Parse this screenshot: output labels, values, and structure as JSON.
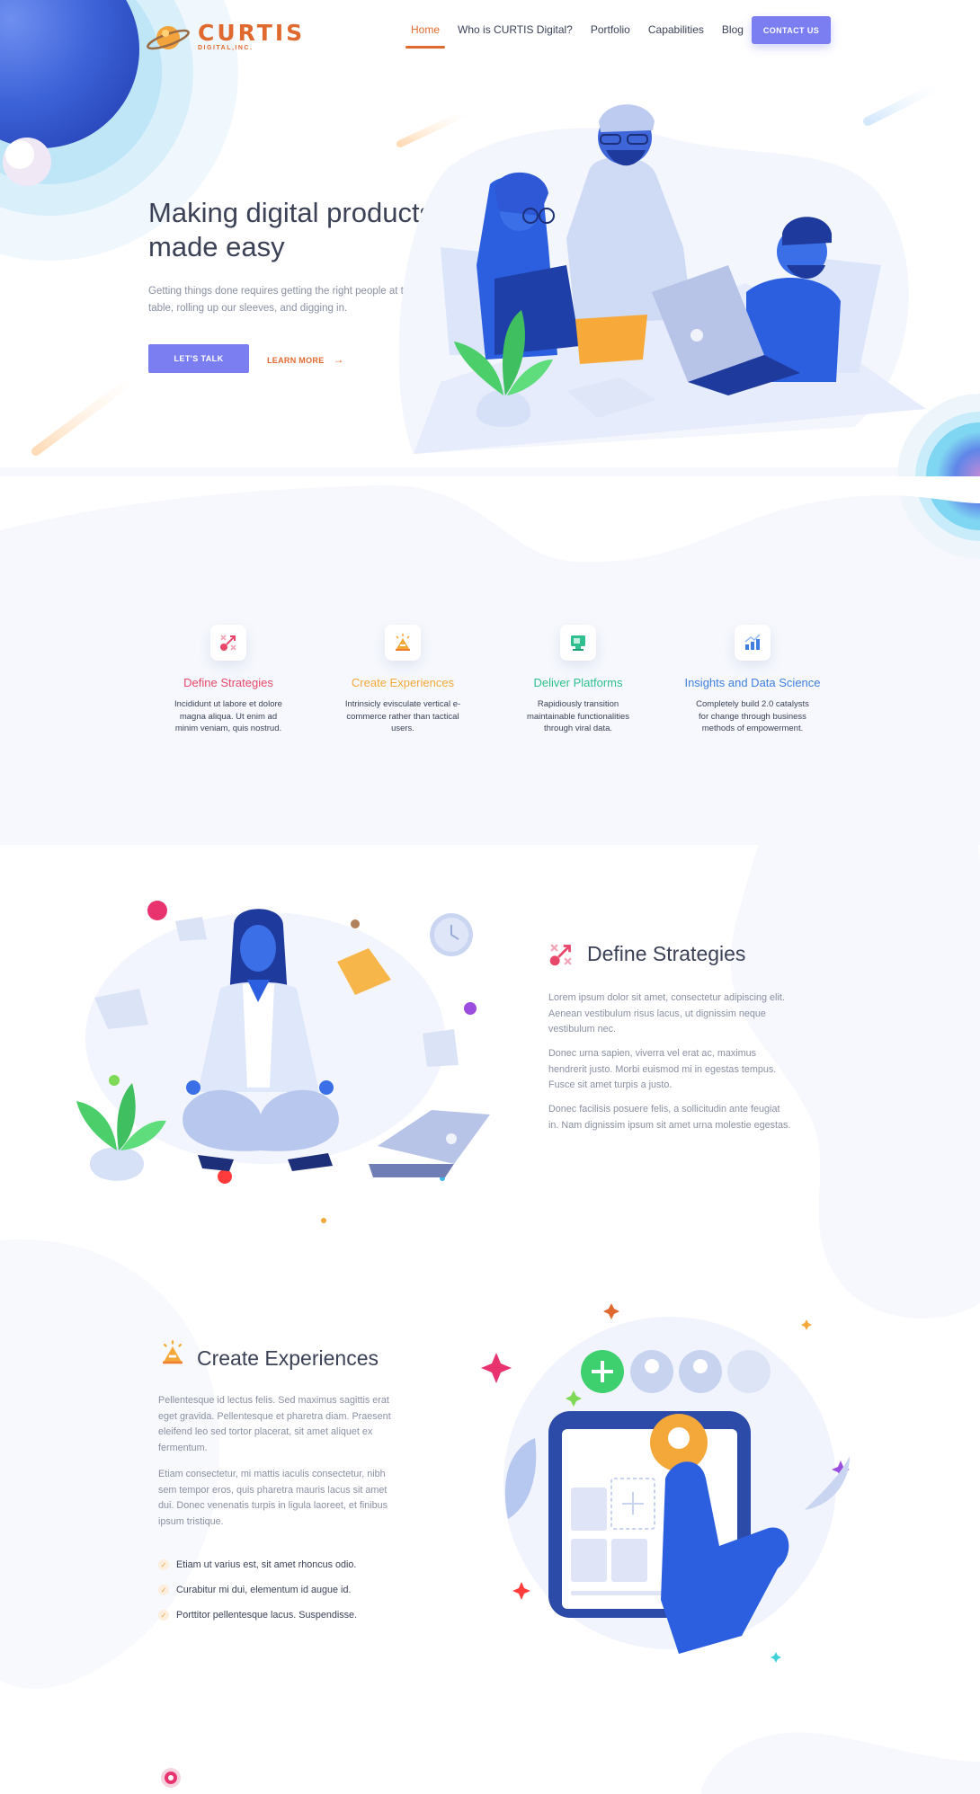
{
  "brand": {
    "name": "CURTIS",
    "tagline": "DIGITAL,INC.",
    "color": "#e0692f"
  },
  "nav": {
    "items": [
      {
        "label": "Home",
        "active": true
      },
      {
        "label": "Who is CURTIS Digital?",
        "active": false
      },
      {
        "label": "Portfolio",
        "active": false
      },
      {
        "label": "Capabilities",
        "active": false
      },
      {
        "label": "Blog",
        "active": false
      }
    ],
    "contact_label": "CONTACT US"
  },
  "hero": {
    "title": "Making digital products made easy",
    "subtitle": "Getting things done requires getting the right people at the table, rolling up our sleeves, and digging in.",
    "primary_cta": "LET'S TALK",
    "secondary_cta": "LEARN MORE"
  },
  "features": [
    {
      "title": "Define Strategies",
      "text": "Incididunt ut labore et dolore magna aliqua. Ut enim ad minim veniam, quis nostrud.",
      "color": "#e8476a",
      "icon": "strategy-icon"
    },
    {
      "title": "Create Experiences",
      "text": "Intrinsicly evisculate vertical e-commerce rather than tactical users.",
      "color": "#f5a83a",
      "icon": "experience-icon"
    },
    {
      "title": "Deliver Platforms",
      "text": "Rapidiously transition maintainable functionalities through viral data.",
      "color": "#2fbf8e",
      "icon": "platform-icon"
    },
    {
      "title": "Insights and Data Science",
      "text": "Completely build 2.0 catalysts for change through business methods of empowerment.",
      "color": "#3f7fe0",
      "icon": "chart-icon"
    }
  ],
  "define_section": {
    "title": "Define Strategies",
    "paragraphs": [
      "Lorem ipsum dolor sit amet, consectetur adipiscing elit. Aenean vestibulum risus lacus, ut dignissim neque vestibulum nec.",
      "Donec urna sapien, viverra vel erat ac, maximus hendrerit justo. Morbi euismod mi in egestas tempus. Fusce sit amet turpis a justo.",
      "Donec facilisis posuere felis, a sollicitudin ante feugiat in. Nam dignissim ipsum sit amet urna molestie egestas."
    ]
  },
  "experience_section": {
    "title": "Create Experiences",
    "paragraphs": [
      "Pellentesque id lectus felis. Sed maximus sagittis erat eget gravida. Pellentesque et pharetra diam. Praesent eleifend leo sed tortor placerat, sit amet aliquet ex fermentum.",
      "Etiam consectetur, mi mattis iaculis consectetur, nibh sem tempor eros, quis pharetra mauris lacus sit amet dui. Donec venenatis turpis in ligula laoreet, et finibus ipsum tristique."
    ],
    "checklist": [
      "Etiam ut varius est, sit amet rhoncus odio.",
      "Curabitur mi dui, elementum id augue id.",
      "Porttitor pellentesque lacus. Suspendisse."
    ]
  },
  "colors": {
    "accent": "#7a7ef0",
    "heading": "#3b4257",
    "body": "#8a90a2"
  }
}
